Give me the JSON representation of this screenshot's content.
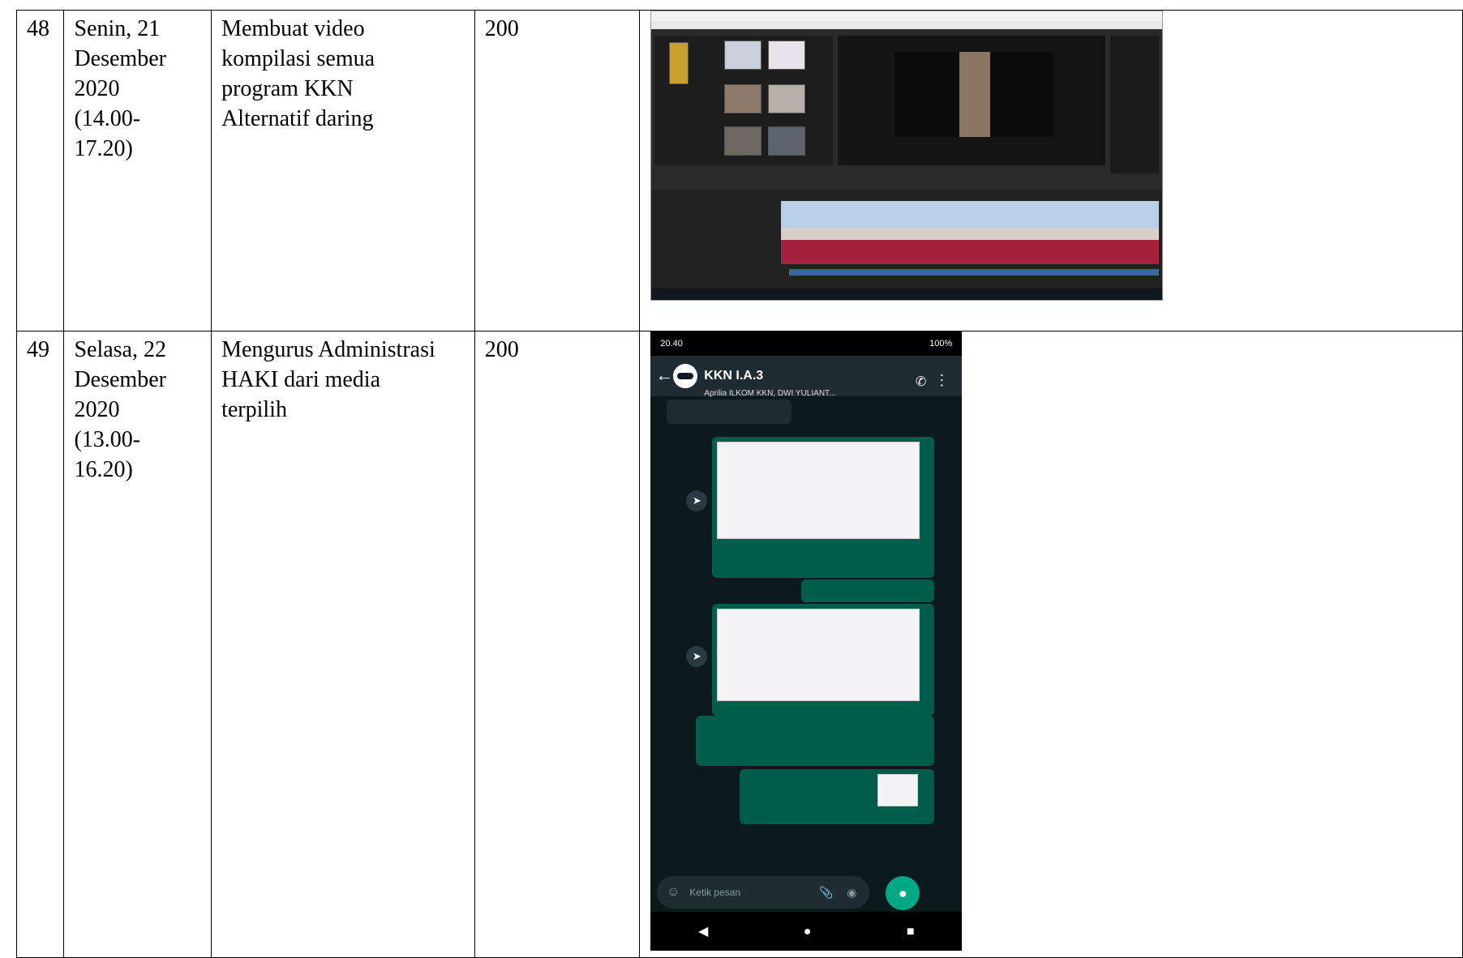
{
  "rows": [
    {
      "no": "48",
      "date": "Senin, 21\nDesember\n2020\n(14.00-\n17.20)",
      "activity": "Membuat video\nkompilasi semua\nprogram KKN\nAlternatif daring",
      "value": "200"
    },
    {
      "no": "49",
      "date": "Selasa, 22\nDesember\n2020\n(13.00-\n16.20)",
      "activity": "Mengurus Administrasi\nHAKI dari media\nterpilih",
      "value": "200",
      "phone": {
        "status_time": "20.40",
        "status_battery": "100%",
        "chat_name": "KKN I.A.3",
        "chat_members": "Aprilia ILKOM KKN, DWI YULIANT...",
        "input_placeholder": "Ketik pesan"
      }
    }
  ],
  "colors": {
    "border": "#000000",
    "whatsapp_dark": "#0c1a1e",
    "whatsapp_bubble": "#005c4b",
    "whatsapp_accent": "#00a884",
    "timeline_audio": "#a3213d",
    "timeline_video": "#b9d0e6"
  }
}
